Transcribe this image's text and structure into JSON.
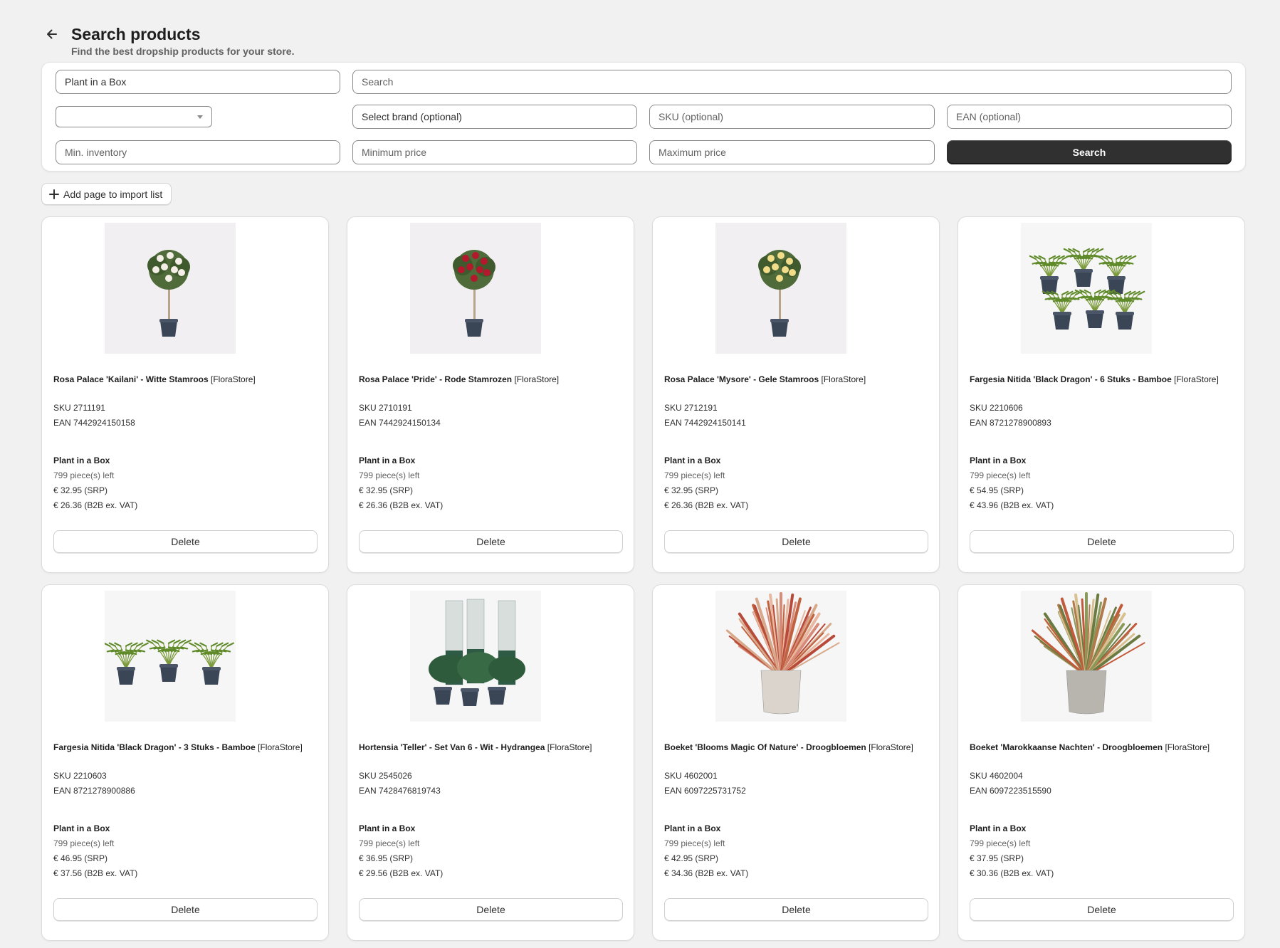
{
  "header": {
    "title": "Search products",
    "subtitle": "Find the best dropship products for your store."
  },
  "filters": {
    "supplier_value": "Plant in a Box",
    "search_placeholder": "Search",
    "category_value": "",
    "brand_placeholder": "Select brand (optional)",
    "sku_placeholder": "SKU (optional)",
    "ean_placeholder": "EAN (optional)",
    "min_inventory_placeholder": "Min. inventory",
    "min_price_placeholder": "Minimum price",
    "max_price_placeholder": "Maximum price",
    "search_button": "Search"
  },
  "add_page_button": "Add page to import list",
  "icons": {
    "back": "arrow-left-icon",
    "add": "plus-icon",
    "dropdown": "chevron-down-icon"
  },
  "products": [
    {
      "name": "Rosa Palace 'Kailani' - Witte Stamroos",
      "store": "[FloraStore]",
      "sku": "SKU 2711191",
      "ean": "EAN 7442924150158",
      "supplier": "Plant in a Box",
      "stock": "799 piece(s) left",
      "srp": "€ 32.95 (SRP)",
      "b2b": "€ 26.36 (B2B ex. VAT)",
      "delete_label": "Delete",
      "image": "rose-white"
    },
    {
      "name": "Rosa Palace 'Pride' - Rode Stamrozen",
      "store": "[FloraStore]",
      "sku": "SKU 2710191",
      "ean": "EAN 7442924150134",
      "supplier": "Plant in a Box",
      "stock": "799 piece(s) left",
      "srp": "€ 32.95 (SRP)",
      "b2b": "€ 26.36 (B2B ex. VAT)",
      "delete_label": "Delete",
      "image": "rose-red"
    },
    {
      "name": "Rosa Palace 'Mysore' - Gele Stamroos",
      "store": "[FloraStore]",
      "sku": "SKU 2712191",
      "ean": "EAN 7442924150141",
      "supplier": "Plant in a Box",
      "stock": "799 piece(s) left",
      "srp": "€ 32.95 (SRP)",
      "b2b": "€ 26.36 (B2B ex. VAT)",
      "delete_label": "Delete",
      "image": "rose-yellow"
    },
    {
      "name": "Fargesia Nitida 'Black Dragon' - 6 Stuks - Bamboe",
      "store": "[FloraStore]",
      "sku": "SKU 2210606",
      "ean": "EAN 8721278900893",
      "supplier": "Plant in a Box",
      "stock": "799 piece(s) left",
      "srp": "€ 54.95 (SRP)",
      "b2b": "€ 43.96 (B2B ex. VAT)",
      "delete_label": "Delete",
      "image": "bamboo-6"
    },
    {
      "name": "Fargesia Nitida 'Black Dragon' - 3 Stuks - Bamboe",
      "store": "[FloraStore]",
      "sku": "SKU 2210603",
      "ean": "EAN 8721278900886",
      "supplier": "Plant in a Box",
      "stock": "799 piece(s) left",
      "srp": "€ 46.95 (SRP)",
      "b2b": "€ 37.56 (B2B ex. VAT)",
      "delete_label": "Delete",
      "image": "bamboo-3"
    },
    {
      "name": "Hortensia 'Teller' - Set Van 6 - Wit - Hydrangea",
      "store": "[FloraStore]",
      "sku": "SKU 2545026",
      "ean": "EAN 7428476819743",
      "supplier": "Plant in a Box",
      "stock": "799 piece(s) left",
      "srp": "€ 36.95 (SRP)",
      "b2b": "€ 29.56 (B2B ex. VAT)",
      "delete_label": "Delete",
      "image": "hydrangea"
    },
    {
      "name": "Boeket 'Blooms Magic Of Nature' - Droogbloemen",
      "store": "[FloraStore]",
      "sku": "SKU 4602001",
      "ean": "EAN 6097225731752",
      "supplier": "Plant in a Box",
      "stock": "799 piece(s) left",
      "srp": "€ 42.95 (SRP)",
      "b2b": "€ 34.36 (B2B ex. VAT)",
      "delete_label": "Delete",
      "image": "bouquet-pink"
    },
    {
      "name": "Boeket 'Marokkaanse Nachten' - Droogbloemen",
      "store": "[FloraStore]",
      "sku": "SKU 4602004",
      "ean": "EAN 6097223515590",
      "supplier": "Plant in a Box",
      "stock": "799 piece(s) left",
      "srp": "€ 37.95 (SRP)",
      "b2b": "€ 30.36 (B2B ex. VAT)",
      "delete_label": "Delete",
      "image": "bouquet-green"
    }
  ]
}
